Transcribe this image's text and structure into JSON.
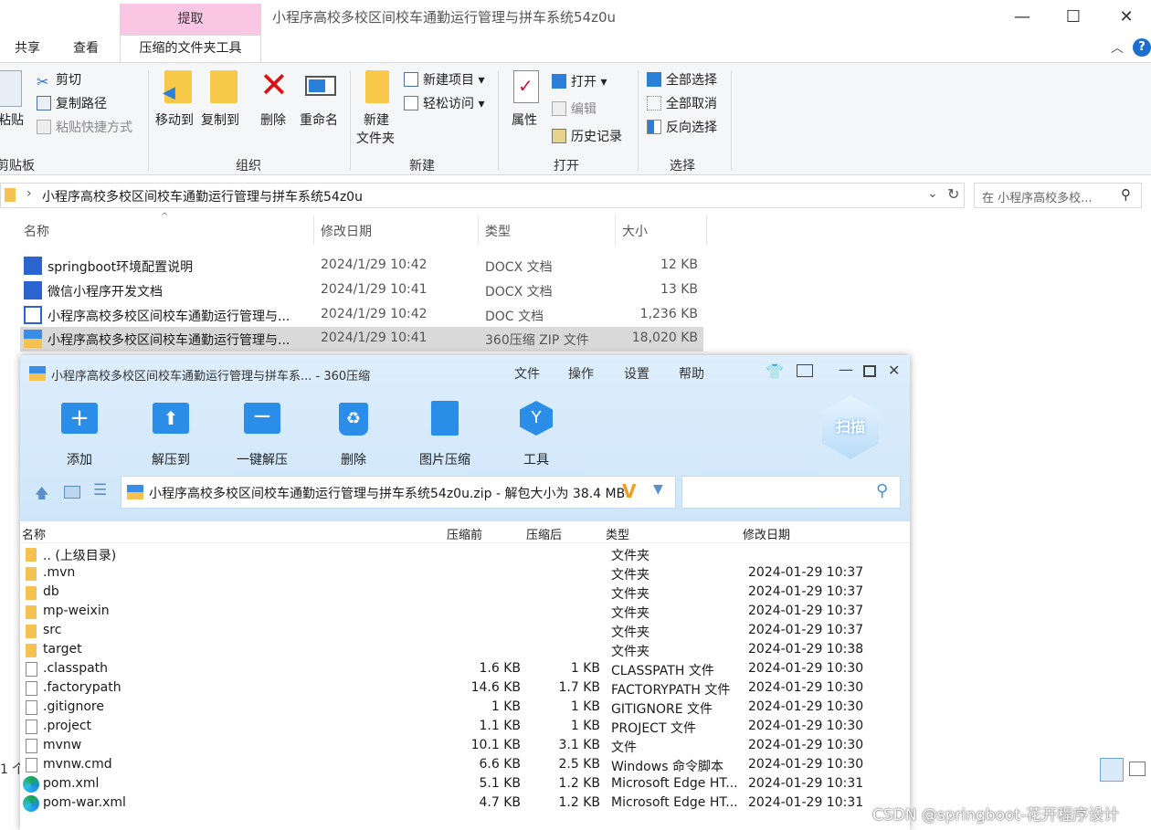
{
  "explorer": {
    "context_tab": "提取",
    "title": "小程序高校多校区间校车通勤运行管理与拼车系统54z0u",
    "tabs": [
      "共享",
      "查看",
      "压缩的文件夹工具"
    ],
    "ribbon": {
      "clipboard": {
        "paste": "粘贴",
        "cut": "剪切",
        "copy_path": "复制路径",
        "paste_shortcut": "粘贴快捷方式",
        "label": "剪贴板"
      },
      "organize": {
        "move_to": "移动到",
        "copy_to": "复制到",
        "delete": "删除",
        "rename": "重命名",
        "label": "组织"
      },
      "new": {
        "new_folder_1": "新建",
        "new_folder_2": "文件夹",
        "new_item": "新建项目",
        "easy_access": "轻松访问",
        "label": "新建"
      },
      "open": {
        "properties": "属性",
        "open": "打开",
        "edit": "编辑",
        "history": "历史记录",
        "label": "打开"
      },
      "select": {
        "select_all": "全部选择",
        "select_none": "全部取消",
        "invert": "反向选择",
        "label": "选择"
      }
    },
    "address": "小程序高校多校区间校车通勤运行管理与拼车系统54z0u",
    "search_placeholder": "在 小程序高校多校...",
    "columns": [
      "名称",
      "修改日期",
      "类型",
      "大小"
    ],
    "files": [
      {
        "name": "springboot环境配置说明",
        "date": "2024/1/29 10:42",
        "type": "DOCX 文档",
        "size": "12 KB"
      },
      {
        "name": "微信小程序开发文档",
        "date": "2024/1/29 10:41",
        "type": "DOCX 文档",
        "size": "13 KB"
      },
      {
        "name": "小程序高校多校区间校车通勤运行管理与...",
        "date": "2024/1/29 10:42",
        "type": "DOC 文档",
        "size": "1,236 KB"
      },
      {
        "name": "小程序高校多校区间校车通勤运行管理与...",
        "date": "2024/1/29 10:41",
        "type": "360压缩 ZIP 文件",
        "size": "18,020 KB"
      }
    ],
    "status_count": "1 个"
  },
  "zip": {
    "title": "小程序高校多校区间校车通勤运行管理与拼车系... - 360压缩",
    "menu": [
      "文件",
      "操作",
      "设置",
      "帮助"
    ],
    "tools": [
      "添加",
      "解压到",
      "一键解压",
      "删除",
      "图片压缩",
      "工具"
    ],
    "scan": "扫描",
    "path": "小程序高校多校区间校车通勤运行管理与拼车系统54z0u.zip - 解包大小为 38.4 MB",
    "columns": [
      "名称",
      "压缩前",
      "压缩后",
      "类型",
      "修改日期"
    ],
    "rows": [
      {
        "name": ".. (上级目录)",
        "before": "",
        "after": "",
        "type": "文件夹",
        "date": "",
        "icon": "folder"
      },
      {
        "name": ".mvn",
        "before": "",
        "after": "",
        "type": "文件夹",
        "date": "2024-01-29 10:37",
        "icon": "folder"
      },
      {
        "name": "db",
        "before": "",
        "after": "",
        "type": "文件夹",
        "date": "2024-01-29 10:37",
        "icon": "folder"
      },
      {
        "name": "mp-weixin",
        "before": "",
        "after": "",
        "type": "文件夹",
        "date": "2024-01-29 10:37",
        "icon": "folder"
      },
      {
        "name": "src",
        "before": "",
        "after": "",
        "type": "文件夹",
        "date": "2024-01-29 10:37",
        "icon": "folder"
      },
      {
        "name": "target",
        "before": "",
        "after": "",
        "type": "文件夹",
        "date": "2024-01-29 10:38",
        "icon": "folder"
      },
      {
        "name": ".classpath",
        "before": "1.6 KB",
        "after": "1 KB",
        "type": "CLASSPATH 文件",
        "date": "2024-01-29 10:30",
        "icon": "file"
      },
      {
        "name": ".factorypath",
        "before": "14.6 KB",
        "after": "1.7 KB",
        "type": "FACTORYPATH 文件",
        "date": "2024-01-29 10:30",
        "icon": "file"
      },
      {
        "name": ".gitignore",
        "before": "1 KB",
        "after": "1 KB",
        "type": "GITIGNORE 文件",
        "date": "2024-01-29 10:30",
        "icon": "file"
      },
      {
        "name": ".project",
        "before": "1.1 KB",
        "after": "1 KB",
        "type": "PROJECT 文件",
        "date": "2024-01-29 10:30",
        "icon": "file"
      },
      {
        "name": "mvnw",
        "before": "10.1 KB",
        "after": "3.1 KB",
        "type": "文件",
        "date": "2024-01-29 10:30",
        "icon": "file"
      },
      {
        "name": "mvnw.cmd",
        "before": "6.6 KB",
        "after": "2.5 KB",
        "type": "Windows 命令脚本",
        "date": "2024-01-29 10:30",
        "icon": "file"
      },
      {
        "name": "pom.xml",
        "before": "5.1 KB",
        "after": "1.2 KB",
        "type": "Microsoft Edge HT...",
        "date": "2024-01-29 10:31",
        "icon": "edge"
      },
      {
        "name": "pom-war.xml",
        "before": "4.7 KB",
        "after": "1.2 KB",
        "type": "Microsoft Edge HT...",
        "date": "2024-01-29 10:31",
        "icon": "edge"
      }
    ]
  },
  "watermark": "CSDN @springboot-花开程序设计"
}
